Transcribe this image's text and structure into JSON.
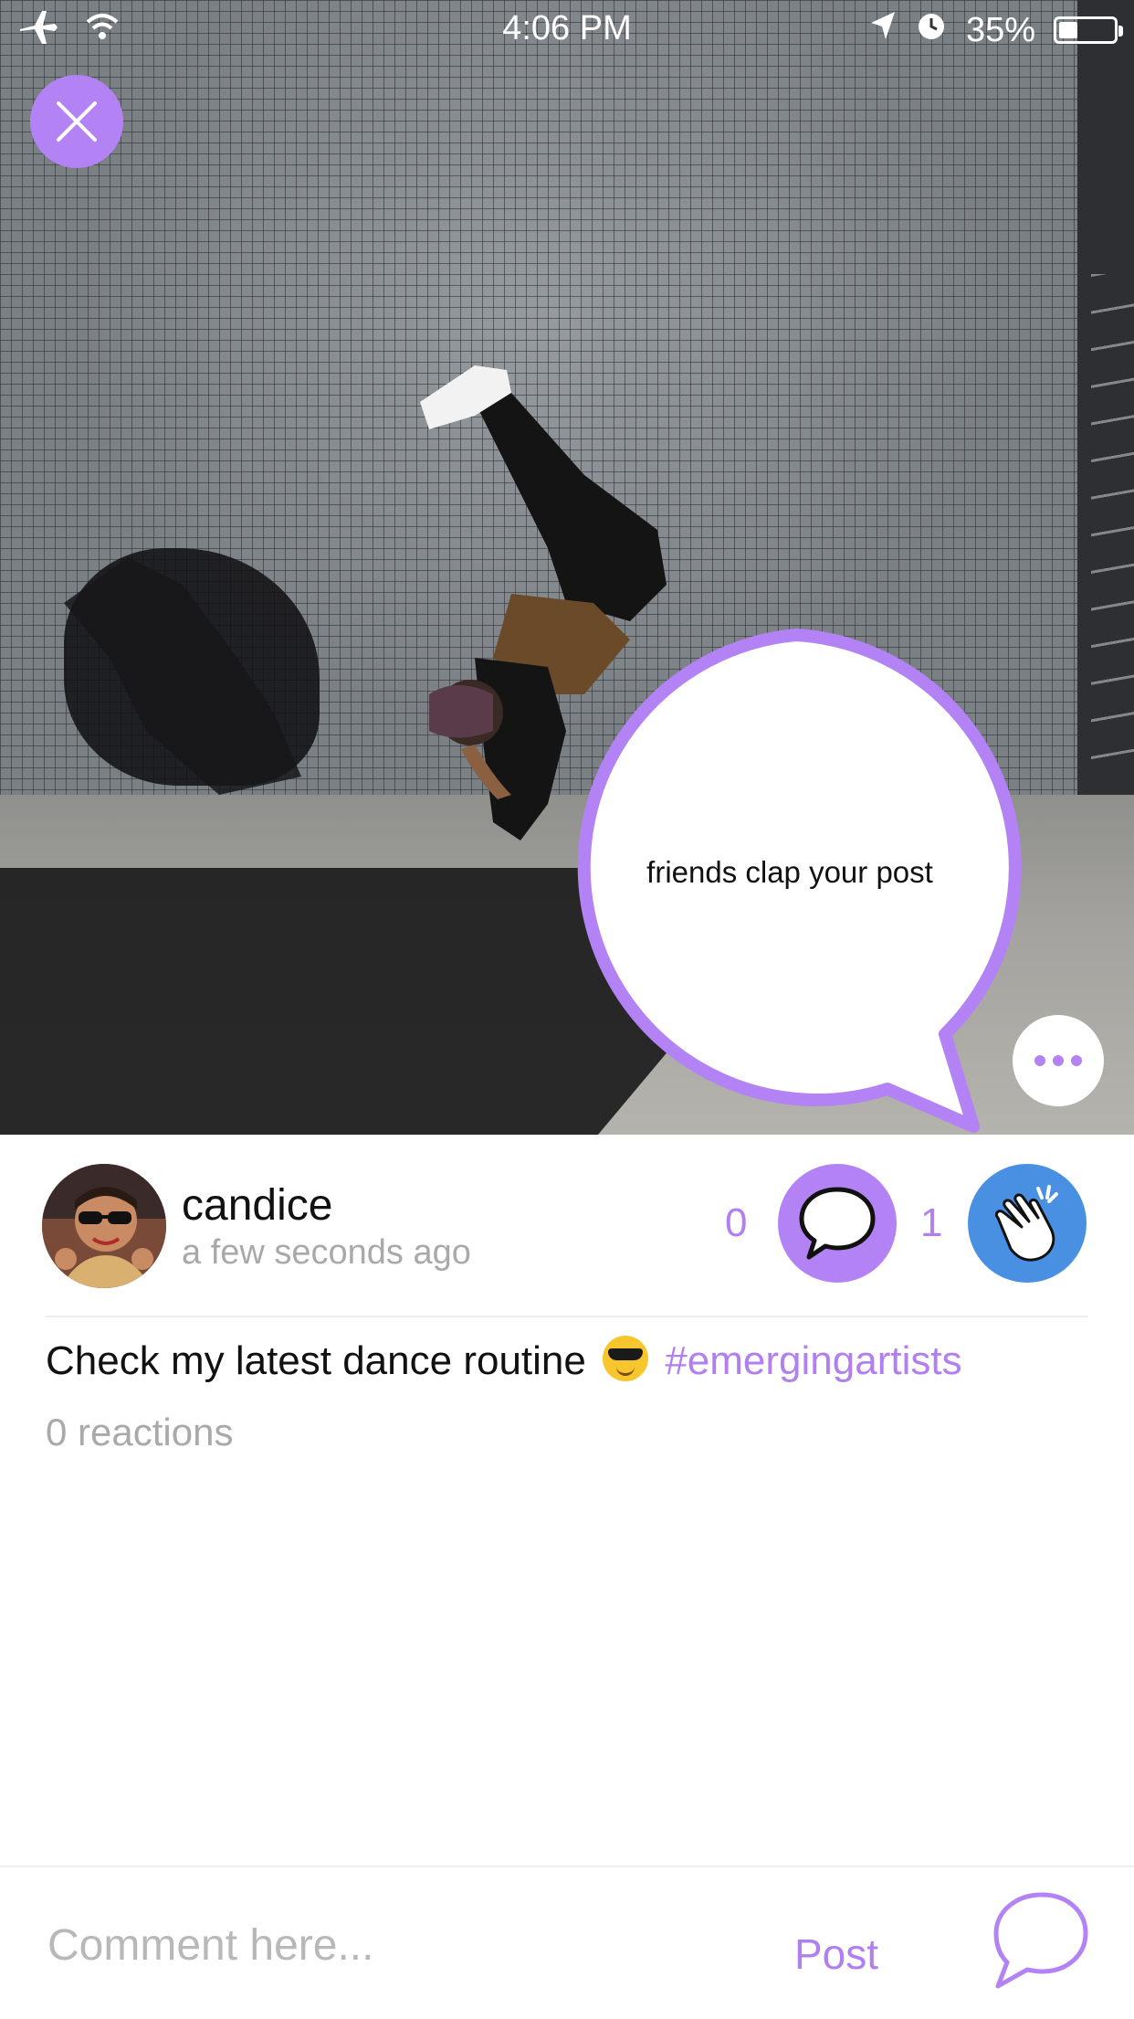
{
  "status_bar": {
    "time": "4:06 PM",
    "battery_text": "35%",
    "battery_level": 0.35,
    "icons": [
      "airplane-icon",
      "wifi-icon",
      "location-arrow-icon",
      "alarm-icon",
      "battery-icon"
    ]
  },
  "photo": {
    "icons": [
      "close-icon",
      "more-icon"
    ]
  },
  "tooltip": {
    "text": "friends clap your post",
    "border_color": "#b383f5"
  },
  "post": {
    "author": "candice",
    "time": "a few seconds ago",
    "comment_count": "0",
    "clap_count": "1",
    "caption_text": "Check my latest dance routine",
    "caption_emoji": "sunglasses-emoji",
    "hashtag": "#emergingartists",
    "reactions": "0 reactions"
  },
  "comment_bar": {
    "placeholder": "Comment here...",
    "post_label": "Post"
  },
  "colors": {
    "accent_purple": "#b383f5",
    "clap_blue": "#4a90e2",
    "muted_text": "#a9a9a9"
  }
}
